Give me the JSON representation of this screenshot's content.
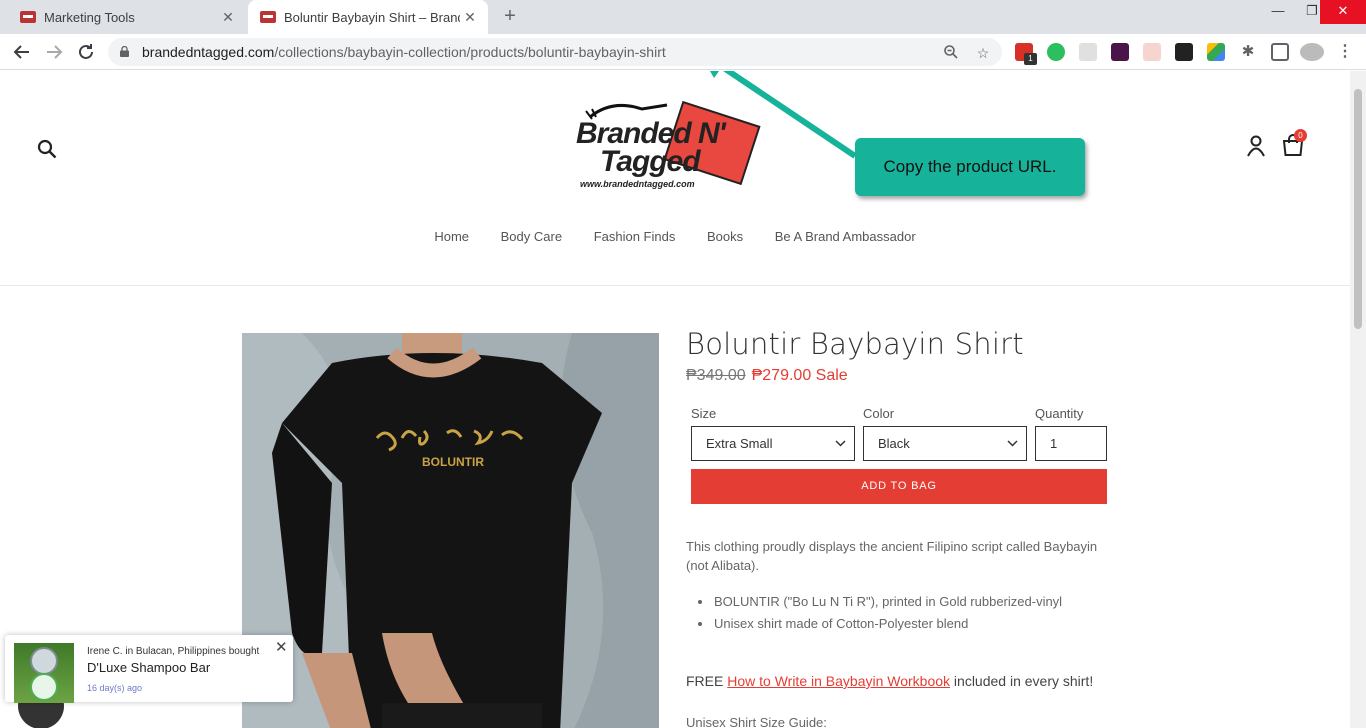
{
  "browser": {
    "tabs": [
      {
        "title": "Marketing Tools",
        "active": false
      },
      {
        "title": "Boluntir Baybayin Shirt – Branded N' Tagged",
        "active": true
      }
    ],
    "url_domain": "brandedntagged.com",
    "url_path": "/collections/baybayin-collection/products/boluntir-baybayin-shirt",
    "extension_badge": "1"
  },
  "store": {
    "logo_line1": "Branded N'",
    "logo_line2": "Tagged",
    "logo_url": "www.brandedntagged.com",
    "cart_count": "0",
    "nav": [
      "Home",
      "Body Care",
      "Fashion Finds",
      "Books",
      "Be A Brand Ambassador"
    ]
  },
  "product": {
    "title": "Boluntir Baybayin Shirt",
    "price_old": "₱349.00",
    "price_new": "₱279.00 Sale",
    "shirt_text": "BOLUNTIR",
    "size_label": "Size",
    "size_value": "Extra Small",
    "color_label": "Color",
    "color_value": "Black",
    "quantity_label": "Quantity",
    "quantity_value": "1",
    "add_button": "ADD TO BAG",
    "description": "This clothing proudly displays the ancient Filipino script called Baybayin (not Alibata).",
    "bullets": [
      "BOLUNTIR (\"Bo Lu N Ti R\"), printed in Gold rubberized-vinyl",
      "Unisex shirt made of Cotton-Polyester blend"
    ],
    "free_prefix": "FREE ",
    "free_link": "How to Write in Baybayin Workbook",
    "free_suffix": " included in every shirt!",
    "size_guide": "Unisex Shirt Size Guide:"
  },
  "annotation": {
    "text": "Copy the product URL.",
    "color": "#16b39a"
  },
  "popup": {
    "who": "Irene C. in Bulacan, Philippines bought",
    "item": "D'Luxe Shampoo Bar",
    "when": "16 day(s) ago"
  },
  "colors": {
    "accent": "#e43d33",
    "annotation": "#16b39a"
  }
}
